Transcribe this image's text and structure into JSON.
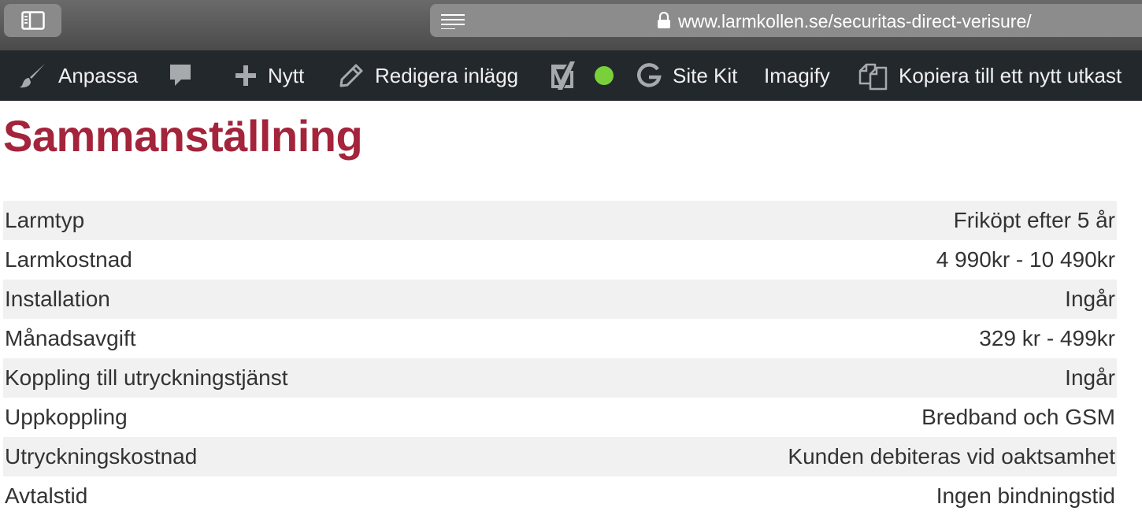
{
  "browser": {
    "url": "www.larmkollen.se/securitas-direct-verisure/"
  },
  "admin_bar": {
    "items": [
      {
        "label": "Anpassa",
        "icon": "paintbrush-icon"
      },
      {
        "label": "",
        "icon": "comment-bubble-icon"
      },
      {
        "label": "Nytt",
        "icon": "plus-icon"
      },
      {
        "label": "Redigera inlägg",
        "icon": "pencil-icon"
      },
      {
        "label": "",
        "icon": "yoast-icon"
      },
      {
        "label": "",
        "icon": "status-dot-icon",
        "color": "#7ad03a"
      },
      {
        "label": "Site Kit",
        "icon": "google-g-icon"
      },
      {
        "label": "Imagify",
        "icon": ""
      },
      {
        "label": "Kopiera till ett nytt utkast",
        "icon": "copy-icon"
      }
    ]
  },
  "main": {
    "title": "Sammanställning",
    "title_color": "#a3243b",
    "rows": [
      {
        "label": "Larmtyp",
        "value": "Friköpt efter 5 år"
      },
      {
        "label": "Larmkostnad",
        "value": "4 990kr - 10 490kr"
      },
      {
        "label": "Installation",
        "value": "Ingår"
      },
      {
        "label": "Månadsavgift",
        "value": "329 kr - 499kr"
      },
      {
        "label": "Koppling till utryckningstjänst",
        "value": "Ingår"
      },
      {
        "label": "Uppkoppling",
        "value": "Bredband och GSM"
      },
      {
        "label": "Utryckningskostnad",
        "value": "Kunden debiteras vid oaktsamhet"
      },
      {
        "label": "Avtalstid",
        "value": "Ingen bindningstid"
      }
    ]
  }
}
